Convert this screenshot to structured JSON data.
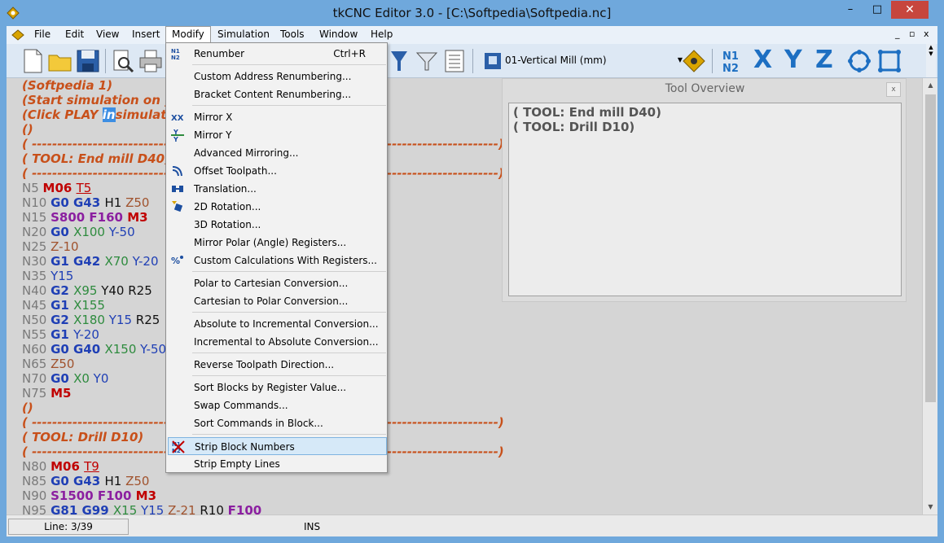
{
  "window": {
    "title": "tkCNC Editor 3.0 - [C:\\Softpedia\\Softpedia.nc]",
    "min": "–",
    "max": "□",
    "close": "✕"
  },
  "menubar": {
    "items": [
      "File",
      "Edit",
      "View",
      "Insert",
      "Modify",
      "Simulation",
      "Tools",
      "Window",
      "Help"
    ],
    "mdi_min": "_",
    "mdi_restore": "▫",
    "mdi_close": "x"
  },
  "toolbar": {
    "machine": "01-Vertical Mill (mm)",
    "axis_x": "X",
    "axis_y": "Y",
    "axis_z": "Z"
  },
  "editor": {
    "comment_lines": [
      "(Softpedia 1)",
      "(Start simulation on y",
      "(Click PLAY ",
      "in",
      "simulat",
      "()"
    ],
    "dashes_long": "( --------------------------------------------------------------------------------------------)",
    "tool1": "( TOOL: End mill D40)",
    "tool2": "( TOOL: Drill D10)",
    "empty": "()",
    "blocks": [
      [
        "N5 ",
        "M06 ",
        "T5"
      ],
      [
        "N10 ",
        "G0 G43 ",
        "H1 ",
        "Z50"
      ],
      [
        "N15 ",
        "S800 F160 ",
        "M3"
      ],
      [
        "N20 ",
        "G0 ",
        "X100 ",
        "Y-50"
      ],
      [
        "N25 ",
        "Z-10"
      ],
      [
        "N30 ",
        "G1 G42 ",
        "X70 ",
        "Y-20"
      ],
      [
        "N35 ",
        "Y15"
      ],
      [
        "N40 ",
        "G2 ",
        "X95 ",
        "Y40 ",
        "R25"
      ],
      [
        "N45 ",
        "G1 ",
        "X155"
      ],
      [
        "N50 ",
        "G2 ",
        "X180 ",
        "Y15 ",
        "R25"
      ],
      [
        "N55 ",
        "G1 ",
        "Y-20"
      ],
      [
        "N60 ",
        "G0 G40 ",
        "X150 ",
        "Y-50"
      ],
      [
        "N65 ",
        "Z50"
      ],
      [
        "N70 ",
        "G0 ",
        "X0 ",
        "Y0"
      ],
      [
        "N75 ",
        "M5"
      ],
      [
        "N80 ",
        "M06 ",
        "T9"
      ],
      [
        "N85 ",
        "G0 G43 ",
        "H1 ",
        "Z50"
      ],
      [
        "N90 ",
        "S1500 F100 ",
        "M3"
      ],
      [
        "N95 ",
        "G81 G99 ",
        "X15 ",
        "Y15 ",
        "Z-21 ",
        "R10 ",
        "F100"
      ]
    ]
  },
  "tool_overview": {
    "title": "Tool Overview",
    "close": "x",
    "lines": [
      "( TOOL: End mill D40)",
      "( TOOL: Drill D10)"
    ]
  },
  "modify_menu": [
    {
      "label": "Renumber",
      "shortcut": "Ctrl+R"
    },
    {
      "label": "Custom Address Renumbering..."
    },
    {
      "label": "Bracket Content Renumbering..."
    },
    {
      "label": "Mirror X"
    },
    {
      "label": "Mirror Y"
    },
    {
      "label": "Advanced Mirroring..."
    },
    {
      "label": "Offset Toolpath..."
    },
    {
      "label": "Translation..."
    },
    {
      "label": "2D Rotation..."
    },
    {
      "label": "3D Rotation..."
    },
    {
      "label": "Mirror Polar (Angle) Registers..."
    },
    {
      "label": "Custom Calculations With Registers..."
    },
    {
      "label": "Polar to Cartesian Conversion..."
    },
    {
      "label": "Cartesian to Polar Conversion..."
    },
    {
      "label": "Absolute to Incremental Conversion..."
    },
    {
      "label": "Incremental to Absolute Conversion..."
    },
    {
      "label": "Reverse Toolpath Direction..."
    },
    {
      "label": "Sort Blocks by Register Value..."
    },
    {
      "label": "Swap Commands..."
    },
    {
      "label": "Sort Commands in Block..."
    },
    {
      "label": "Strip Block Numbers"
    },
    {
      "label": "Strip Empty Lines"
    }
  ],
  "status": {
    "line": "Line: 3/39",
    "mode": "INS"
  }
}
